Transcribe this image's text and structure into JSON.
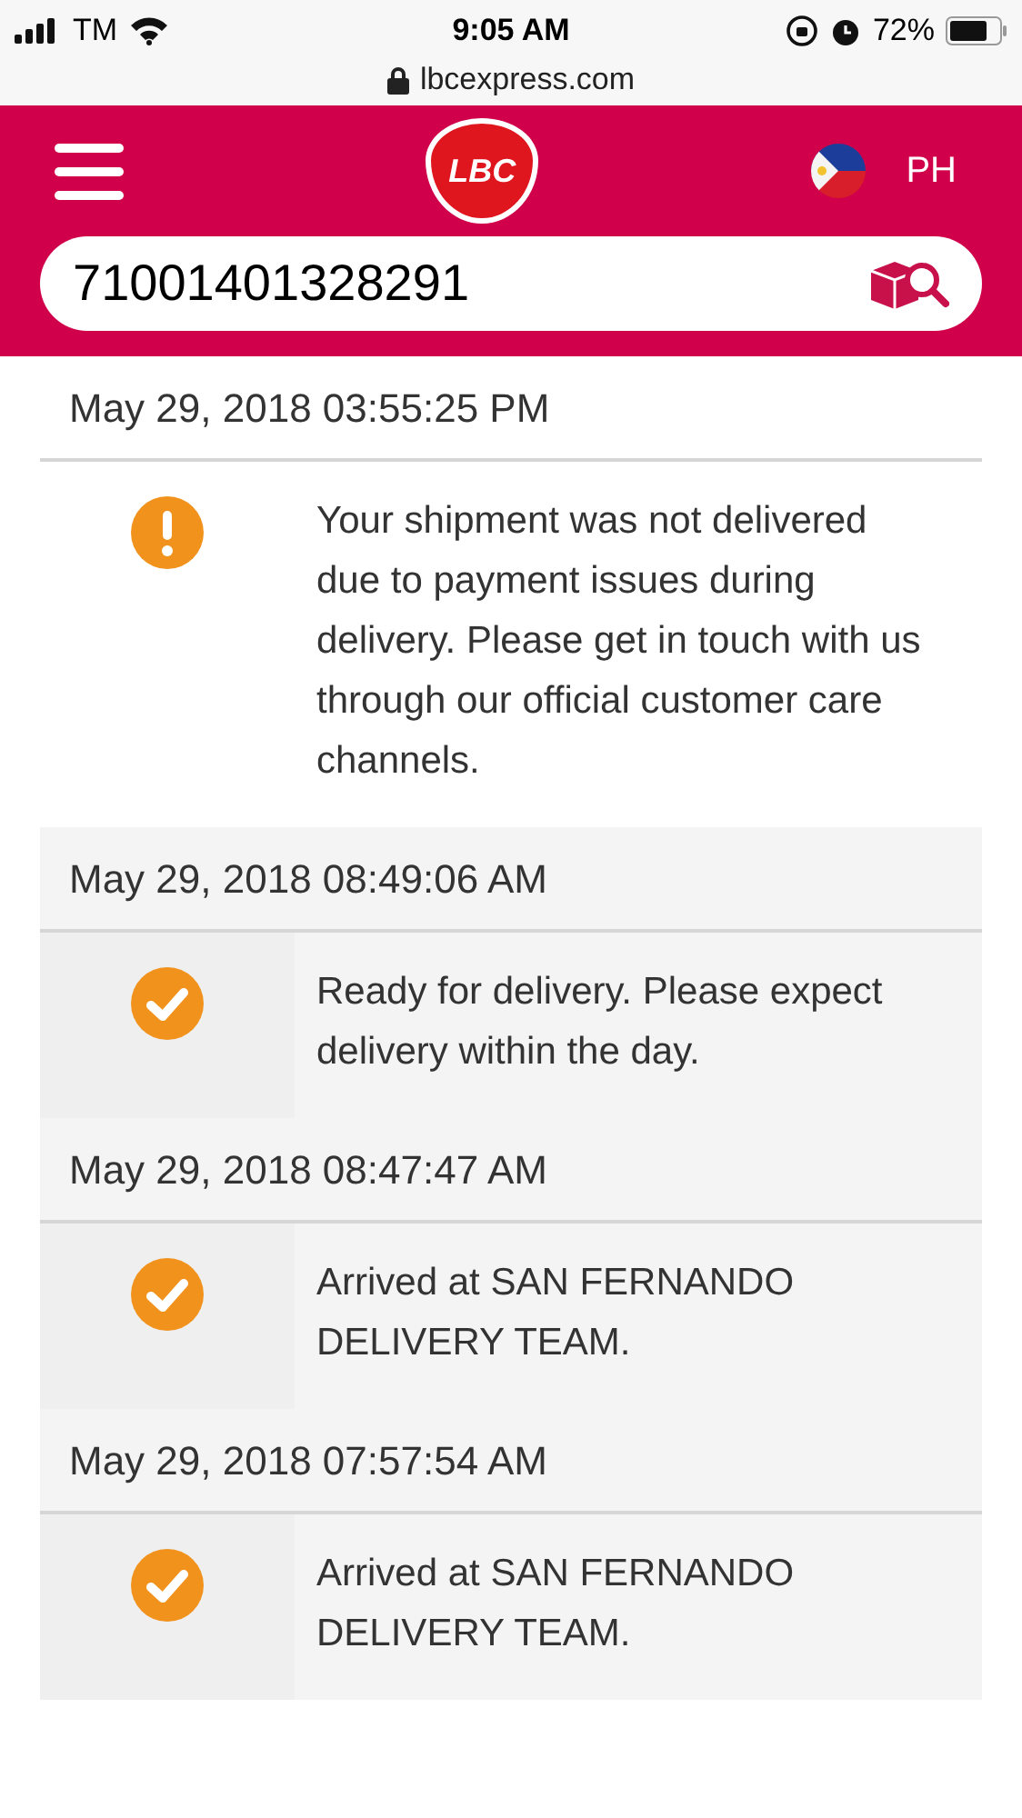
{
  "status_bar": {
    "carrier": "TM",
    "time": "9:05 AM",
    "battery": "72%"
  },
  "browser": {
    "url": "lbcexpress.com"
  },
  "header": {
    "logo": "LBC",
    "country": "PH"
  },
  "search": {
    "value": "71001401328291"
  },
  "events": [
    {
      "kind": "warning",
      "timestamp": "May 29, 2018 03:55:25 PM",
      "message": "Your shipment was not delivered due to payment issues during delivery. Please get in touch with us through our official customer care channels."
    },
    {
      "kind": "done",
      "timestamp": "May 29, 2018 08:49:06 AM",
      "message": "Ready for delivery. Please expect delivery within the day."
    },
    {
      "kind": "done",
      "timestamp": "May 29, 2018 08:47:47 AM",
      "message": "Arrived at SAN FERNANDO DELIVERY TEAM."
    },
    {
      "kind": "done",
      "timestamp": "May 29, 2018 07:57:54 AM",
      "message": "Arrived at SAN FERNANDO DELIVERY TEAM."
    }
  ]
}
